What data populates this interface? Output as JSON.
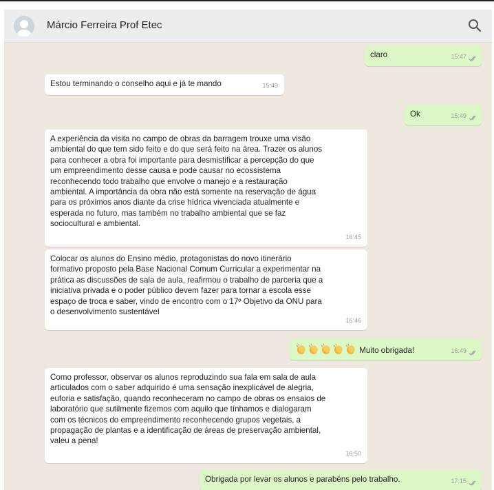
{
  "contact": {
    "name": "Márcio Ferreira Prof Etec"
  },
  "colors": {
    "incoming": "#ffffff",
    "outgoing": "#dcf8c6",
    "background": "#efe8df",
    "ticks": "#9a9a9a"
  },
  "icons": {
    "search": "search-icon",
    "avatar": "default-avatar",
    "read_receipt": "double-check-icon",
    "emoji": "clapping-hands"
  },
  "messages": [
    {
      "direction": "out",
      "text": "claro",
      "time": "15:47"
    },
    {
      "direction": "in",
      "text": "Estou terminando o conselho aqui e já te mando",
      "time": "15:49"
    },
    {
      "direction": "out",
      "text": "Ok",
      "time": "15:49"
    },
    {
      "direction": "in",
      "lines": [
        "A experiência da visita no campo de obras da barragem trouxe uma visão",
        "ambiental do que tem sido feito e do que será feito na área. Trazer os alunos",
        "para conhecer a obra foi importante para desmistificar a percepção do que",
        "um empreendimento desse causa e pode causar no ecossistema",
        "reconhecendo todo trabalho que envolve o manejo  e a restauração",
        "ambiental. A importância da obra não está somente na reservação de água",
        "para os próximos anos diante da crise hídrica vivenciada atualmente e",
        "esperada no futuro, mas também no trabalho ambiental que se faz",
        "sociocultural e ambiental."
      ],
      "time": "16:45"
    },
    {
      "direction": "in",
      "lines": [
        "Colocar os alunos do Ensino médio, protagonistas  do novo itinerário",
        "formativo proposto pela Base Nacional Comum Curricular a experimentar na",
        "prática as discussões de sala de aula, reafirmou o trabalho de parceria que a",
        "iniciativa privada e o poder público devem fazer para tornar a escola esse",
        "espaço de troca e saber, vindo de encontro com o 17º Objetivo da ONU para",
        "o desenvolvimento sustentável"
      ],
      "time": "16:46"
    },
    {
      "direction": "out",
      "emoji_count": 5,
      "text": "Muito obrigada!",
      "time": "16:49"
    },
    {
      "direction": "in",
      "lines": [
        "Como professor, observar os alunos reproduzindo sua fala em sala de aula",
        "articulados com o saber adquirido é uma sensação inexplicável de alegria,",
        "euforia e satisfação, quando reconheceram no campo de obras os ensaios de",
        "laboratório que sutilmente fizemos com aquilo que tínhamos  e dialogaram",
        "com os técnicos do empreendimento  reconhecendo grupos vegetais, a",
        "propagação de plantas e a identificação de áreas de preservação ambiental,",
        "valeu a pena!"
      ],
      "time": "16:50"
    },
    {
      "direction": "out",
      "text": "Obrigada por levar os alunos e parabéns pelo trabalho.",
      "time": "17:15"
    }
  ]
}
